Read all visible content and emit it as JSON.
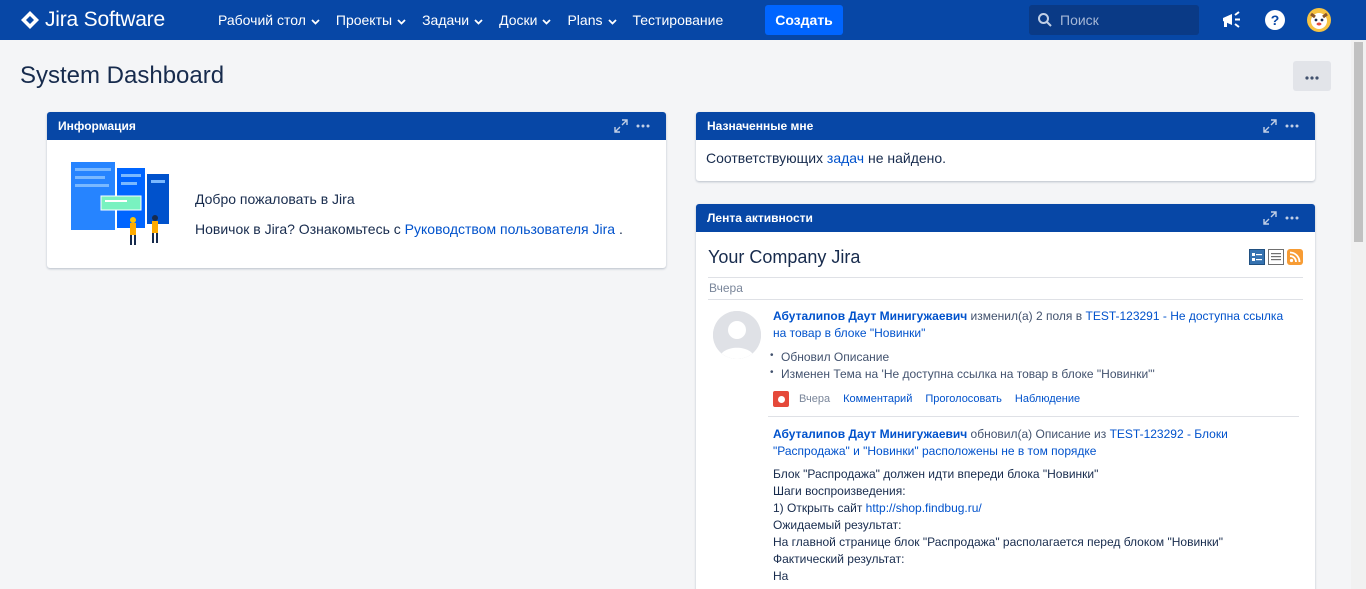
{
  "nav": {
    "brand": "Jira Software",
    "menu": [
      {
        "label": "Рабочий стол",
        "dropdown": true
      },
      {
        "label": "Проекты",
        "dropdown": true
      },
      {
        "label": "Задачи",
        "dropdown": true
      },
      {
        "label": "Доски",
        "dropdown": true
      },
      {
        "label": "Plans",
        "dropdown": true
      },
      {
        "label": "Тестирование",
        "dropdown": false
      }
    ],
    "create_label": "Создать",
    "search_placeholder": "Поиск",
    "icons": [
      "jira-logo-icon",
      "search-icon",
      "megaphone-icon",
      "help-icon",
      "avatar-icon"
    ]
  },
  "page": {
    "title": "System Dashboard",
    "tools_label": "···"
  },
  "gadgets": {
    "info": {
      "title": "Информация",
      "welcome": "Добро пожаловать в Jira",
      "newbie_prefix": "Новичок в Jira? Ознакомьтесь с",
      "newbie_link": "Руководством пользователя Jira",
      "newbie_suffix": " ."
    },
    "assigned": {
      "title": "Назначенные мне",
      "text_prefix": "Соответствующих ",
      "text_link": "задач",
      "text_suffix": " не найдено."
    },
    "activity": {
      "title": "Лента активности",
      "stream_title": "Your Company Jira",
      "day_label": "Вчера",
      "entries": [
        {
          "author": "Абуталипов Даут Минигужаевич",
          "verb": " изменил(а) 2 поля в ",
          "issue_line1": "TEST-123291 - Не доступна ссылка",
          "issue_line2": "на товар в блоке \"Новинки\"",
          "changes": [
            "Обновил Описание",
            "Изменен Тема на 'Не доступна ссылка на товар в блоке \"Новинки\"'"
          ],
          "when": "Вчера",
          "actions": [
            "Комментарий",
            "Проголосовать",
            "Наблюдение"
          ]
        },
        {
          "author": "Абуталипов Даут Минигужаевич",
          "verb": " обновил(а) Описание из ",
          "issue_line1": "TEST-123292 - Блоки",
          "issue_line2": "\"Распродажа\" и \"Новинки\" расположены не в том порядке",
          "body": [
            "Блок \"Распродажа\" должен идти впереди блока \"Новинки\"",
            "Шаги воспроизведения:",
            "1) Открыть сайт ",
            "Ожидаемый результат:",
            "На главной странице блок \"Распродажа\" располагается перед блоком \"Новинки\"",
            "Фактический результат:",
            "На"
          ],
          "body_link": "http://shop.findbug.ru/"
        }
      ]
    }
  },
  "colors": {
    "nav_bg": "#0747a6",
    "create_bg": "#0065ff",
    "link": "#0052cc",
    "page_bg": "#f4f5f7"
  }
}
